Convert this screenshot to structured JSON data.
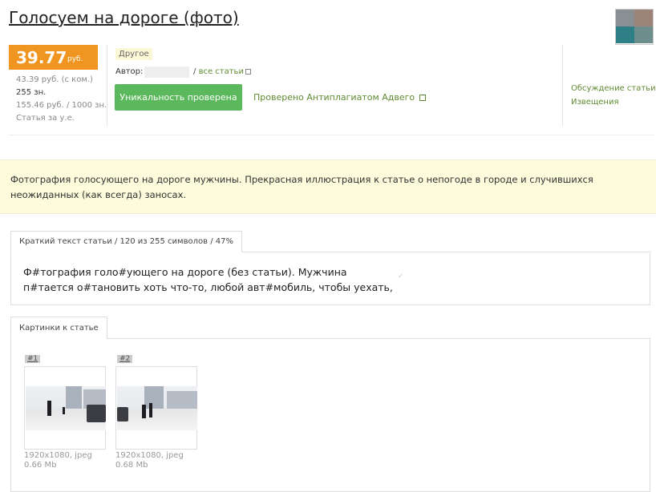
{
  "header": {
    "title": "Голосуем на дороге (фото)"
  },
  "price": {
    "value": "39.77",
    "currency": "руб.",
    "with_commission": "43.39 руб. (с ком.)",
    "chars": "255 зн.",
    "per_1000": "155.46 руб. / 1000 зн.",
    "payment_type": "Статья за у.е."
  },
  "meta": {
    "category": "Другое",
    "author_label": "Автор:",
    "all_articles_sep": "/ ",
    "all_articles_link": "все статьи",
    "unique_button": "Уникальность проверена",
    "advego_link": "Проверено Антиплагиатом Адвего"
  },
  "side_links": {
    "discussion": "Обсуждение статьи",
    "notices": "Извещения"
  },
  "description": "Фотография голосующего на дороге мужчины. Прекрасная иллюстрация к статье о непогоде в городе и случившихся неожиданных (как всегда) заносах.",
  "short_text": {
    "tab_label": "Краткий текст статьи / 120 из 255 символов / 47%",
    "content": "Ф#тография голо#ующего на дороге (без статьи). Мужчина п#тается о#тановить хоть что-то, любой авт#мобиль, чтобы уехать,"
  },
  "images": {
    "tab_label": "Картинки к статье",
    "items": [
      {
        "tag": "#1",
        "resolution": "1920x1080, jpeg",
        "size": "0.66 Mb"
      },
      {
        "tag": "#2",
        "resolution": "1920x1080, jpeg",
        "size": "0.68 Mb"
      }
    ]
  },
  "colors": {
    "price_bg": "#f0951f",
    "button_bg": "#5cb85c",
    "link": "#5f8a32",
    "desc_bg": "#fcfbdb"
  }
}
